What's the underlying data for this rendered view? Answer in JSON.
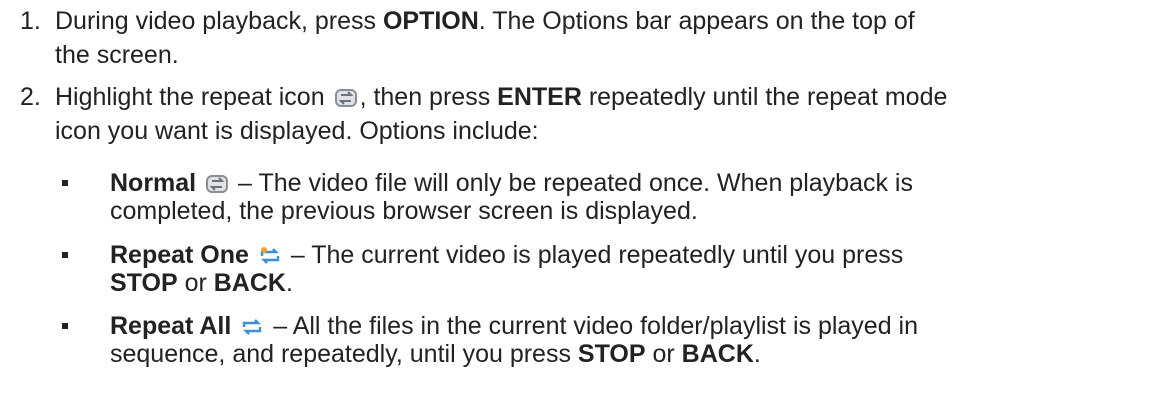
{
  "steps": [
    {
      "number": "1.",
      "line1_before": "During video playback, press ",
      "line1_bold": "OPTION",
      "line1_after": ". The Options bar appears on the top of",
      "line2": "the screen."
    },
    {
      "number": "2.",
      "line1_before": "Highlight the repeat icon ",
      "line1_mid": ", then press ",
      "line1_bold": "ENTER",
      "line1_after": " repeatedly until the repeat mode",
      "line2": "icon you want is displayed. Options include:"
    }
  ],
  "options": [
    {
      "title": "Normal",
      "icon": "repeat-normal-icon",
      "line1": " – The video file will only be repeated once. When playback is",
      "line2": "completed, the previous browser screen is displayed."
    },
    {
      "title": "Repeat One",
      "icon": "repeat-one-icon",
      "line1": " – The current video is played repeatedly until you press",
      "line2_bold1": "STOP",
      "line2_mid": " or ",
      "line2_bold2": "BACK",
      "line2_end": "."
    },
    {
      "title": "Repeat All",
      "icon": "repeat-all-icon",
      "line1": " – All the files in the current video folder/playlist is played in",
      "line2_before": "sequence, and repeatedly, until you press ",
      "line2_bold1": "STOP",
      "line2_mid": " or ",
      "line2_bold2": "BACK",
      "line2_end": "."
    }
  ],
  "colors": {
    "text": "#222222",
    "icon_gray": "#8a8f96",
    "icon_blue": "#3a8fd6",
    "icon_orange": "#f0a030"
  }
}
